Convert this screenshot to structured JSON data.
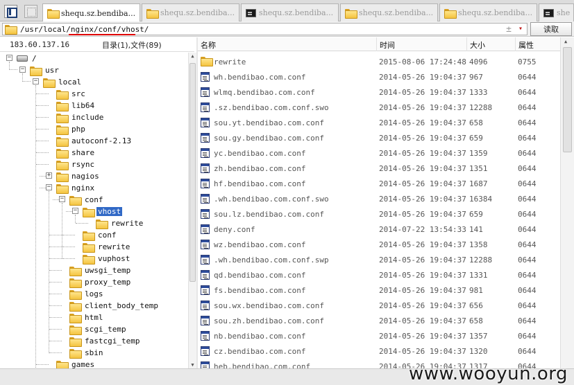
{
  "tabs": [
    {
      "label": "shequ.sz.bendiba...",
      "icon": "folder-icon",
      "active": true
    },
    {
      "label": "shequ.sz.bendiba...",
      "icon": "folder-icon",
      "active": false
    },
    {
      "label": "shequ.sz.bendiba...",
      "icon": "terminal-icon",
      "active": false
    },
    {
      "label": "shequ.sz.bendiba...",
      "icon": "folder-icon",
      "active": false
    },
    {
      "label": "shequ.sz.bendiba...",
      "icon": "folder-icon",
      "active": false
    },
    {
      "label": "she",
      "icon": "terminal-icon",
      "active": false
    }
  ],
  "pathbar": {
    "path": "/usr/local/nginx/conf/vhost/",
    "plus_glyph": "±",
    "drop_glyph": "▾",
    "read_label": "读取"
  },
  "left": {
    "ip": "183.60.137.16",
    "counts": "目录(1),文件(89)",
    "tree": [
      {
        "label": "/",
        "icon": "drive"
      },
      {
        "label": "usr",
        "icon": "folder"
      },
      {
        "label": "local",
        "icon": "folder"
      },
      {
        "label": "src",
        "icon": "folder"
      },
      {
        "label": "lib64",
        "icon": "folder"
      },
      {
        "label": "include",
        "icon": "folder"
      },
      {
        "label": "php",
        "icon": "folder"
      },
      {
        "label": "autoconf-2.13",
        "icon": "folder"
      },
      {
        "label": "share",
        "icon": "folder"
      },
      {
        "label": "rsync",
        "icon": "folder"
      },
      {
        "label": "nagios",
        "icon": "folder"
      },
      {
        "label": "nginx",
        "icon": "folder"
      },
      {
        "label": "conf",
        "icon": "folder"
      },
      {
        "label": "vhost",
        "icon": "folder",
        "selected": true
      },
      {
        "label": "rewrite",
        "icon": "folder"
      },
      {
        "label": "conf",
        "icon": "folder"
      },
      {
        "label": "rewrite",
        "icon": "folder"
      },
      {
        "label": "vuphost",
        "icon": "folder"
      },
      {
        "label": "uwsgi_temp",
        "icon": "folder"
      },
      {
        "label": "proxy_temp",
        "icon": "folder"
      },
      {
        "label": "logs",
        "icon": "folder"
      },
      {
        "label": "client_body_temp",
        "icon": "folder"
      },
      {
        "label": "html",
        "icon": "folder"
      },
      {
        "label": "scgi_temp",
        "icon": "folder"
      },
      {
        "label": "fastcgi_temp",
        "icon": "folder"
      },
      {
        "label": "sbin",
        "icon": "folder"
      },
      {
        "label": "games",
        "icon": "folder"
      }
    ]
  },
  "list": {
    "headers": {
      "name": "名称",
      "time": "时间",
      "size": "大小",
      "attr": "属性"
    },
    "rows": [
      {
        "icon": "folder",
        "name": "rewrite",
        "time": "2015-08-06 17:24:48",
        "size": "4096",
        "attr": "0755"
      },
      {
        "icon": "file",
        "name": "wh.bendibao.com.conf",
        "time": "2014-05-26 19:04:37",
        "size": "967",
        "attr": "0644"
      },
      {
        "icon": "file",
        "name": "wlmq.bendibao.com.conf",
        "time": "2014-05-26 19:04:37",
        "size": "1333",
        "attr": "0644"
      },
      {
        "icon": "file",
        "name": ".sz.bendibao.com.conf.swo",
        "time": "2014-05-26 19:04:37",
        "size": "12288",
        "attr": "0644"
      },
      {
        "icon": "file",
        "name": "sou.yt.bendibao.com.conf",
        "time": "2014-05-26 19:04:37",
        "size": "658",
        "attr": "0644"
      },
      {
        "icon": "file",
        "name": "sou.gy.bendibao.com.conf",
        "time": "2014-05-26 19:04:37",
        "size": "659",
        "attr": "0644"
      },
      {
        "icon": "file",
        "name": "yc.bendibao.com.conf",
        "time": "2014-05-26 19:04:37",
        "size": "1359",
        "attr": "0644"
      },
      {
        "icon": "file",
        "name": "zh.bendibao.com.conf",
        "time": "2014-05-26 19:04:37",
        "size": "1351",
        "attr": "0644"
      },
      {
        "icon": "file",
        "name": "hf.bendibao.com.conf",
        "time": "2014-05-26 19:04:37",
        "size": "1687",
        "attr": "0644"
      },
      {
        "icon": "file",
        "name": ".wh.bendibao.com.conf.swo",
        "time": "2014-05-26 19:04:37",
        "size": "16384",
        "attr": "0644"
      },
      {
        "icon": "file",
        "name": "sou.lz.bendibao.com.conf",
        "time": "2014-05-26 19:04:37",
        "size": "659",
        "attr": "0644"
      },
      {
        "icon": "file",
        "name": "deny.conf",
        "time": "2014-07-22 13:54:33",
        "size": "141",
        "attr": "0644"
      },
      {
        "icon": "file",
        "name": "wz.bendibao.com.conf",
        "time": "2014-05-26 19:04:37",
        "size": "1358",
        "attr": "0644"
      },
      {
        "icon": "file",
        "name": ".wh.bendibao.com.conf.swp",
        "time": "2014-05-26 19:04:37",
        "size": "12288",
        "attr": "0644"
      },
      {
        "icon": "file",
        "name": "qd.bendibao.com.conf",
        "time": "2014-05-26 19:04:37",
        "size": "1331",
        "attr": "0644"
      },
      {
        "icon": "file",
        "name": "fs.bendibao.com.conf",
        "time": "2014-05-26 19:04:37",
        "size": "981",
        "attr": "0644"
      },
      {
        "icon": "file",
        "name": "sou.wx.bendibao.com.conf",
        "time": "2014-05-26 19:04:37",
        "size": "656",
        "attr": "0644"
      },
      {
        "icon": "file",
        "name": "sou.zh.bendibao.com.conf",
        "time": "2014-05-26 19:04:37",
        "size": "658",
        "attr": "0644"
      },
      {
        "icon": "file",
        "name": "nb.bendibao.com.conf",
        "time": "2014-05-26 19:04:37",
        "size": "1357",
        "attr": "0644"
      },
      {
        "icon": "file",
        "name": "cz.bendibao.com.conf",
        "time": "2014-05-26 19:04:37",
        "size": "1320",
        "attr": "0644"
      },
      {
        "icon": "file",
        "name": "heb.bendibao.com.conf",
        "time": "2014-05-26 19:04:37",
        "size": "1317",
        "attr": "0644"
      }
    ]
  },
  "watermark": "www.wooyun.org",
  "colors": {
    "selection": "#3169c6",
    "path_underline": "#e00000",
    "folder": "#f4c440"
  }
}
